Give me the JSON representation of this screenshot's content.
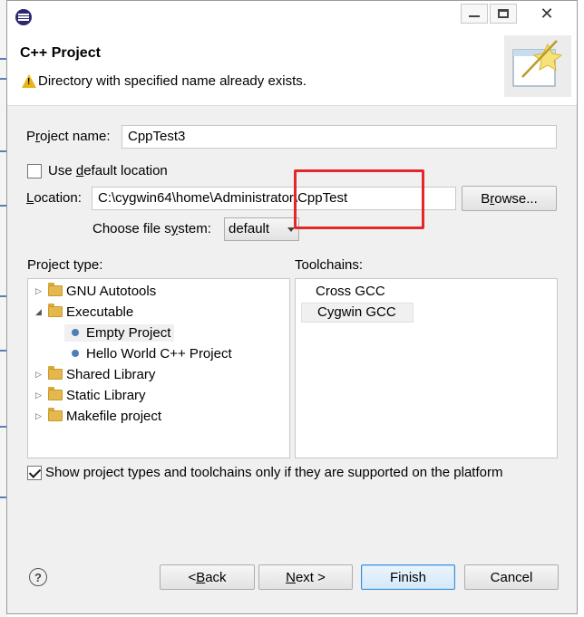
{
  "window": {
    "app_icon": "eclipse-icon",
    "minimize_icon": "minimize-icon",
    "maximize_icon": "maximize-icon",
    "close_symbol": "✕"
  },
  "header": {
    "title": "C++ Project",
    "message": "Directory with specified name already exists.",
    "message_icon": "warning-icon",
    "banner_icon": "new-project-wizard-icon"
  },
  "form": {
    "project_name_label_pre": "P",
    "project_name_label_u": "r",
    "project_name_label_post": "oject name:",
    "project_name_value": "CppTest3",
    "use_default_pre": "Use ",
    "use_default_u": "d",
    "use_default_post": "efault location",
    "use_default_checked": false,
    "location_label_u": "L",
    "location_label_post": "ocation:",
    "location_value": "C:\\cygwin64\\home\\Administrator\\CppTest",
    "browse_pre": "B",
    "browse_u": "r",
    "browse_post": "owse...",
    "filesystem_label_pre": "Choose file s",
    "filesystem_label_u": "y",
    "filesystem_label_post": "stem:",
    "filesystem_value": "default"
  },
  "project_types": {
    "label": "Project type:",
    "items": [
      {
        "label": "GNU Autotools",
        "expander": "▷",
        "icon": "folder-icon"
      },
      {
        "label": "Executable",
        "expander": "◢",
        "icon": "folder-icon"
      },
      {
        "label": "Empty Project",
        "icon": "project-icon",
        "selected": true
      },
      {
        "label": "Hello World C++ Project",
        "icon": "project-icon"
      },
      {
        "label": "Shared Library",
        "expander": "▷",
        "icon": "folder-icon"
      },
      {
        "label": "Static Library",
        "expander": "▷",
        "icon": "folder-icon"
      },
      {
        "label": "Makefile project",
        "expander": "▷",
        "icon": "folder-icon"
      }
    ]
  },
  "toolchains": {
    "label": "Toolchains:",
    "items": [
      {
        "label": "Cross GCC"
      },
      {
        "label": "Cygwin GCC",
        "selected": true
      }
    ]
  },
  "show_supported": {
    "label": "Show project types and toolchains only if they are supported on the platform",
    "checked": true
  },
  "buttons": {
    "back_pre": "< ",
    "back_u": "B",
    "back_post": "ack",
    "next_u": "N",
    "next_post": "ext >",
    "finish": "Finish",
    "cancel": "Cancel",
    "help": "?"
  },
  "colors": {
    "annotation_red": "#e5262a",
    "primary_button_border": "#3c8dde",
    "warning_yellow": "#e8b418"
  }
}
